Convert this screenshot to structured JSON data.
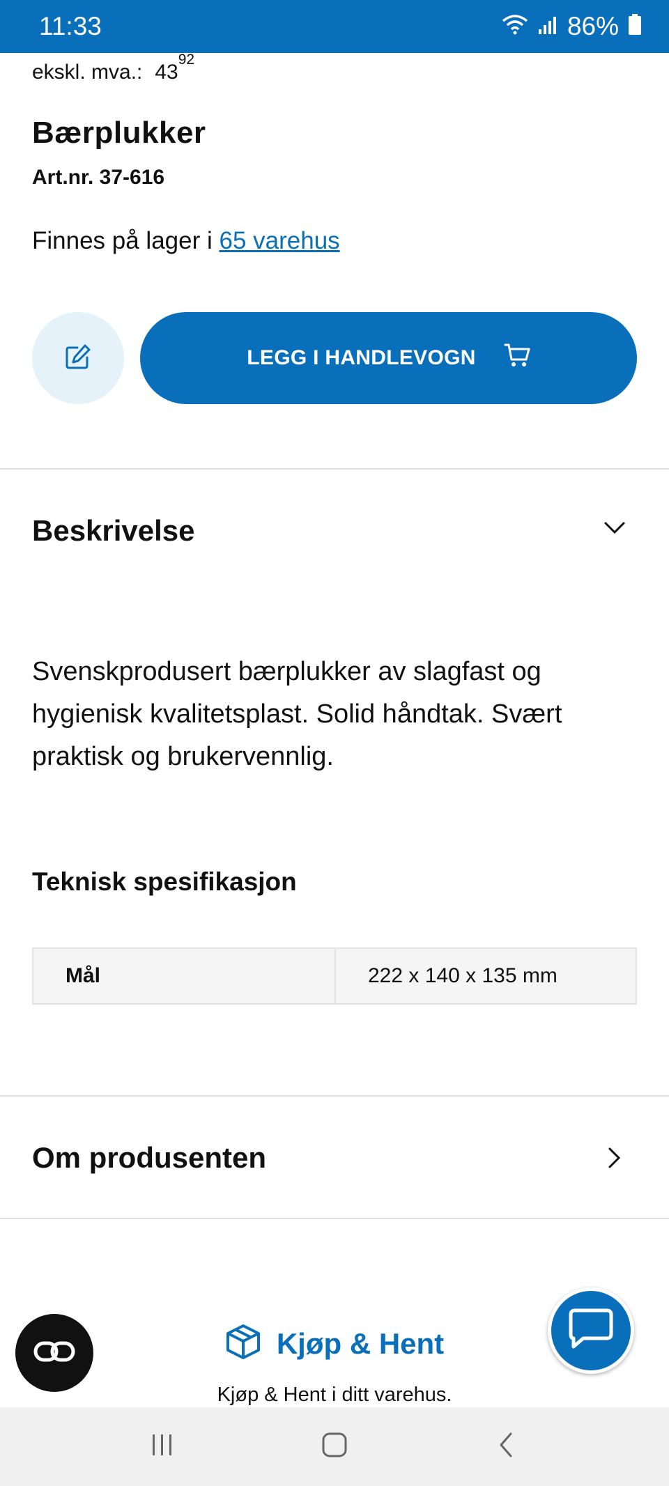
{
  "status_bar": {
    "time": "11:33",
    "battery": "86%",
    "icons": [
      "wifi-icon",
      "signal-icon",
      "battery-icon"
    ]
  },
  "product": {
    "price_label": "ekskl. mva.:",
    "price_main": "43",
    "price_cents": "92",
    "title": "Bærplukker",
    "art_nr": "Art.nr. 37-616",
    "stock_prefix": "Finnes på lager i ",
    "stock_link": "65 varehus"
  },
  "actions": {
    "list_icon": "edit-note-icon",
    "cart_label": "LEGG I HANDLEVOGN",
    "cart_icon": "cart-icon"
  },
  "description_section": {
    "title": "Beskrivelse",
    "text": "Svenskprodusert bærplukker av slagfast og hygienisk kvalitetsplast. Solid håndtak. Svært praktisk og brukervennlig."
  },
  "spec_section": {
    "title": "Teknisk spesifikasjon",
    "rows": [
      {
        "key": "Mål",
        "value": "222 x 140 x 135 mm"
      }
    ]
  },
  "producer_section": {
    "title": "Om produsenten"
  },
  "promo": {
    "title": "Kjøp & Hent",
    "subtitle": "Kjøp & Hent i ditt varehus."
  },
  "colors": {
    "accent": "#0a6fba",
    "accent_light": "#e5f2fa"
  }
}
